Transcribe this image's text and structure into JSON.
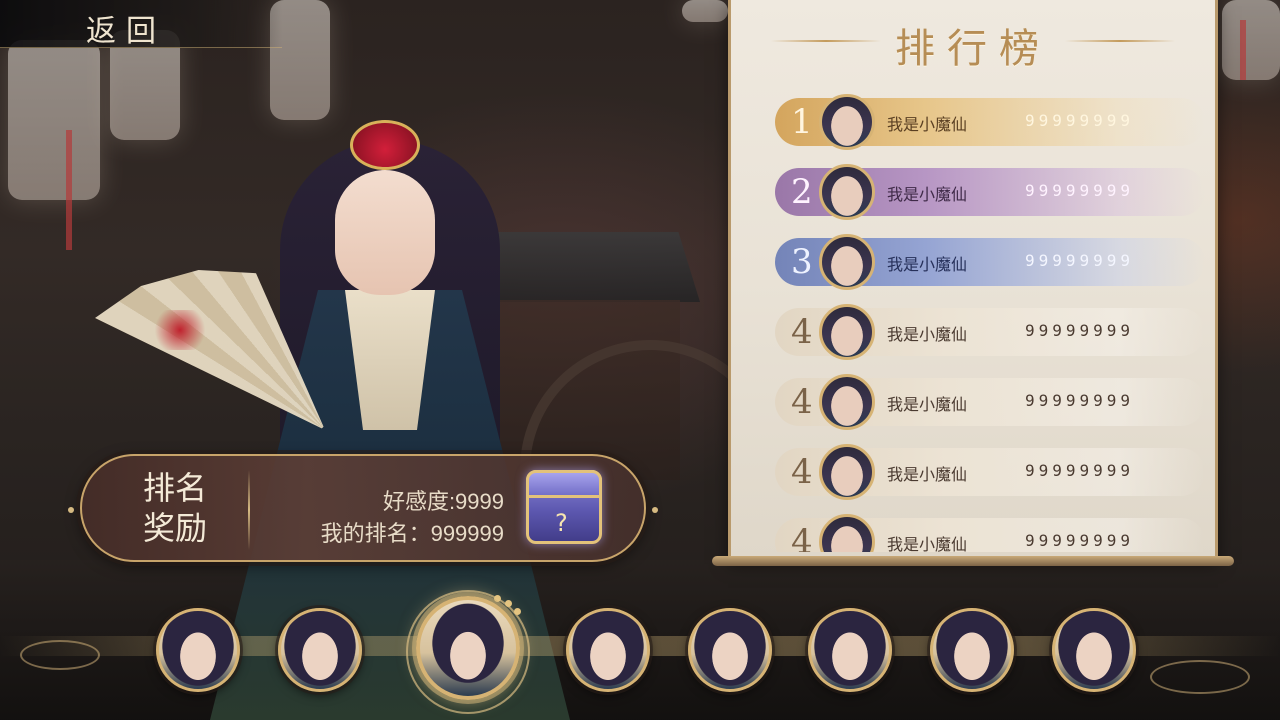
{
  "header": {
    "back_label": "返回"
  },
  "reward_panel": {
    "title": "排名\n奖励",
    "title_line1": "排名",
    "title_line2": "奖励",
    "affection": "好感度:9999",
    "my_rank": "我的排名：999999",
    "chest_icon": "treasure-chest-icon"
  },
  "leaderboard": {
    "title": "排行榜",
    "rows": [
      {
        "rank": "1",
        "name": "我是小魔仙",
        "score": "99999999"
      },
      {
        "rank": "2",
        "name": "我是小魔仙",
        "score": "99999999"
      },
      {
        "rank": "3",
        "name": "我是小魔仙",
        "score": "99999999"
      },
      {
        "rank": "4",
        "name": "我是小魔仙",
        "score": "99999999"
      },
      {
        "rank": "4",
        "name": "我是小魔仙",
        "score": "99999999"
      },
      {
        "rank": "4",
        "name": "我是小魔仙",
        "score": "99999999"
      },
      {
        "rank": "4",
        "name": "我是小魔仙",
        "score": "99999999"
      }
    ],
    "colors": {
      "gold": "#d4a55d",
      "purple": "#9a77a8",
      "blue": "#7484b8",
      "neutral": "#e2d6c3"
    }
  },
  "character_selector": {
    "count": 8,
    "selected_index": 2
  }
}
